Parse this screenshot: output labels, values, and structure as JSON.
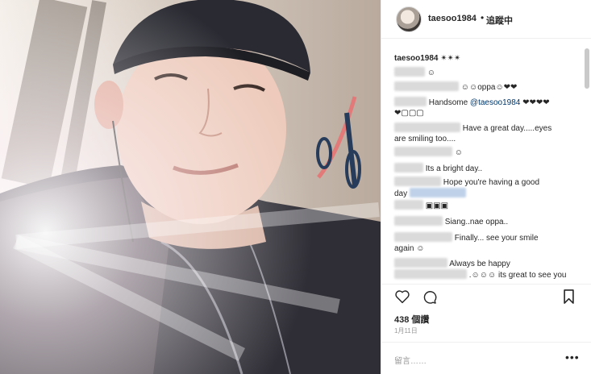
{
  "post": {
    "image_alt": "selfie photo",
    "username": "taesoo1984",
    "separator": "•",
    "follow_status": "追蹤中",
    "likes": "438 個讚",
    "date": "1月11日",
    "comment_placeholder": "留言……",
    "more_label": "•••"
  },
  "comments": [
    {
      "user": "taesoo1984",
      "text": "✴✴✴"
    },
    {
      "text": "☺"
    },
    {
      "text": "☺☺oppa☺❤❤"
    },
    {
      "text": "Handsome ",
      "mention": "@taesoo1984",
      "tail": " ❤❤❤❤",
      "line2": "❤▢▢▢"
    },
    {
      "text": "Have a great day.....eyes",
      "line2": "are smiling too...."
    },
    {
      "text": "☺"
    },
    {
      "text": "Its a bright day.."
    },
    {
      "text": "Hope you're having a good",
      "line2": "day"
    },
    {
      "text": "▣▣▣"
    },
    {
      "text": "Siang..nae oppa.."
    },
    {
      "text": "Finally... see your smile",
      "line2": "again ☺"
    },
    {
      "text": "Always be happy",
      "line2": ".☺☺☺ its great to see you"
    }
  ]
}
